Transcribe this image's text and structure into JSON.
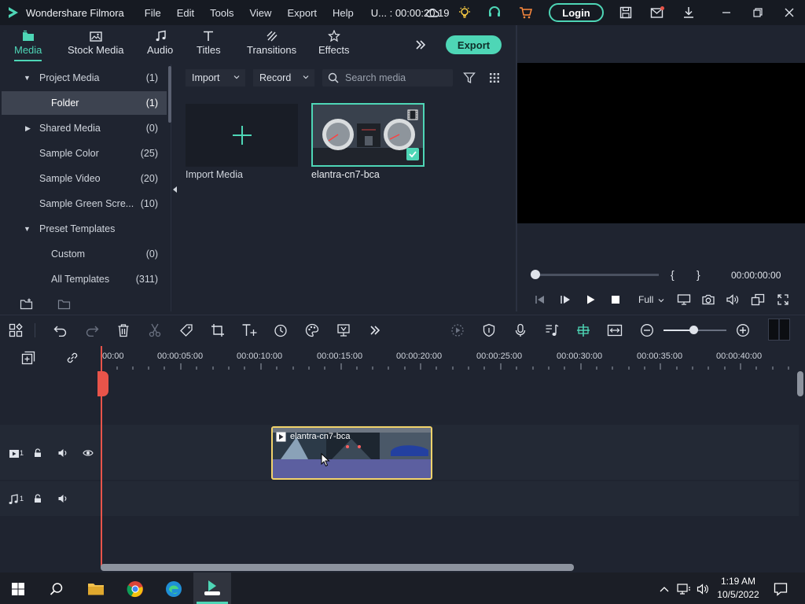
{
  "app": {
    "title": "Wondershare Filmora",
    "menu": [
      "File",
      "Edit",
      "Tools",
      "View",
      "Export",
      "Help"
    ],
    "project_time": "U... : 00:00:20:19",
    "login_label": "Login"
  },
  "tabs": [
    {
      "label": "Media",
      "icon": "media-icon",
      "active": true
    },
    {
      "label": "Stock Media",
      "icon": "stock-media-icon",
      "active": false
    },
    {
      "label": "Audio",
      "icon": "audio-icon",
      "active": false
    },
    {
      "label": "Titles",
      "icon": "titles-icon",
      "active": false
    },
    {
      "label": "Transitions",
      "icon": "transitions-icon",
      "active": false
    },
    {
      "label": "Effects",
      "icon": "effects-icon",
      "active": false
    }
  ],
  "export_label": "Export",
  "tree": [
    {
      "label": "Project Media",
      "count": "(1)",
      "arrow": "▼"
    },
    {
      "label": "Folder",
      "count": "(1)",
      "arrow": "",
      "selected": true
    },
    {
      "label": "Shared Media",
      "count": "(0)",
      "arrow": "▶"
    },
    {
      "label": "Sample Color",
      "count": "(25)",
      "arrow": ""
    },
    {
      "label": "Sample Video",
      "count": "(20)",
      "arrow": ""
    },
    {
      "label": "Sample Green Scre...",
      "count": "(10)",
      "arrow": ""
    },
    {
      "label": "Preset Templates",
      "count": "",
      "arrow": "▼"
    },
    {
      "label": "Custom",
      "count": "(0)",
      "arrow": ""
    },
    {
      "label": "All Templates",
      "count": "(311)",
      "arrow": ""
    }
  ],
  "media_toolbar": {
    "import_label": "Import",
    "record_label": "Record",
    "search_placeholder": "Search media"
  },
  "media_items": {
    "import_label": "Import Media",
    "clip_name": "elantra-cn7-bca"
  },
  "preview": {
    "brace_open": "{",
    "brace_close": "}",
    "timecode": "00:00:00:00",
    "quality": "Full"
  },
  "ruler": [
    "00:00",
    "00:00:05:00",
    "00:00:10:00",
    "00:00:15:00",
    "00:00:20:00",
    "00:00:25:00",
    "00:00:30:00",
    "00:00:35:00",
    "00:00:40:00"
  ],
  "tracks": {
    "video_label": "1",
    "audio_label": "1",
    "clip_label": "elantra-cn7-bca"
  },
  "taskbar": {
    "time": "1:19 AM",
    "date": "10/5/2022"
  },
  "colors": {
    "accent": "#4ed6b6",
    "clip_border": "#f2d36b",
    "playhead": "#e8544a"
  }
}
